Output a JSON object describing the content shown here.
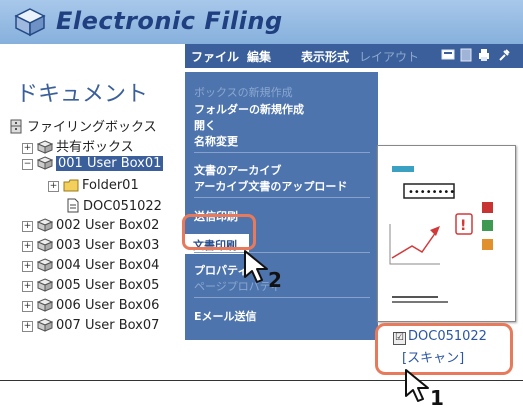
{
  "app": {
    "title": "Electronic Filing"
  },
  "menubar": {
    "items": [
      {
        "label": "ファイル",
        "enabled": true
      },
      {
        "label": "編集",
        "enabled": true
      },
      {
        "label": "表示形式",
        "enabled": true
      },
      {
        "label": "レイアウト",
        "enabled": false
      }
    ],
    "toolbar_icons": [
      "view-icon",
      "list-icon",
      "print-icon",
      "tools-icon"
    ]
  },
  "tree": {
    "title": "ドキュメント",
    "root": "ファイリングボックス",
    "shared": "共有ボックス",
    "boxes": [
      "001 User Box01",
      "002 User Box02",
      "003 User Box03",
      "004 User Box04",
      "005 User Box05",
      "006 User Box06",
      "007 User Box07"
    ],
    "folder": "Folder01",
    "document": "DOC051022"
  },
  "context_menu": {
    "items": [
      {
        "label": "ボックスの新規作成",
        "enabled": false
      },
      {
        "label": "フォルダーの新規作成",
        "enabled": true
      },
      {
        "label": "開く",
        "enabled": true
      },
      {
        "label": "名称変更",
        "enabled": true
      },
      {
        "label": "文書のアーカイブ",
        "enabled": true
      },
      {
        "label": "アーカイブ文書のアップロード",
        "enabled": true
      },
      {
        "label": "送信印刷",
        "enabled": true
      },
      {
        "label": "文書印刷",
        "enabled": true,
        "highlighted": true
      },
      {
        "label": "プロパティ",
        "enabled": true
      },
      {
        "label": "ページプロパティ",
        "enabled": false
      },
      {
        "label": "Eメール送信",
        "enabled": true
      }
    ]
  },
  "preview": {
    "doc_name": "DOC051022",
    "doc_type": "[スキャン]",
    "checked": true,
    "check_mark": "☑",
    "password_dots": "••••••••"
  },
  "callouts": {
    "step1": "1",
    "step2": "2"
  },
  "colors": {
    "menu_bg": "#4d74ad",
    "title_text": "#1f3f80",
    "callout": "#e87a5c",
    "link": "#2b56a6"
  }
}
